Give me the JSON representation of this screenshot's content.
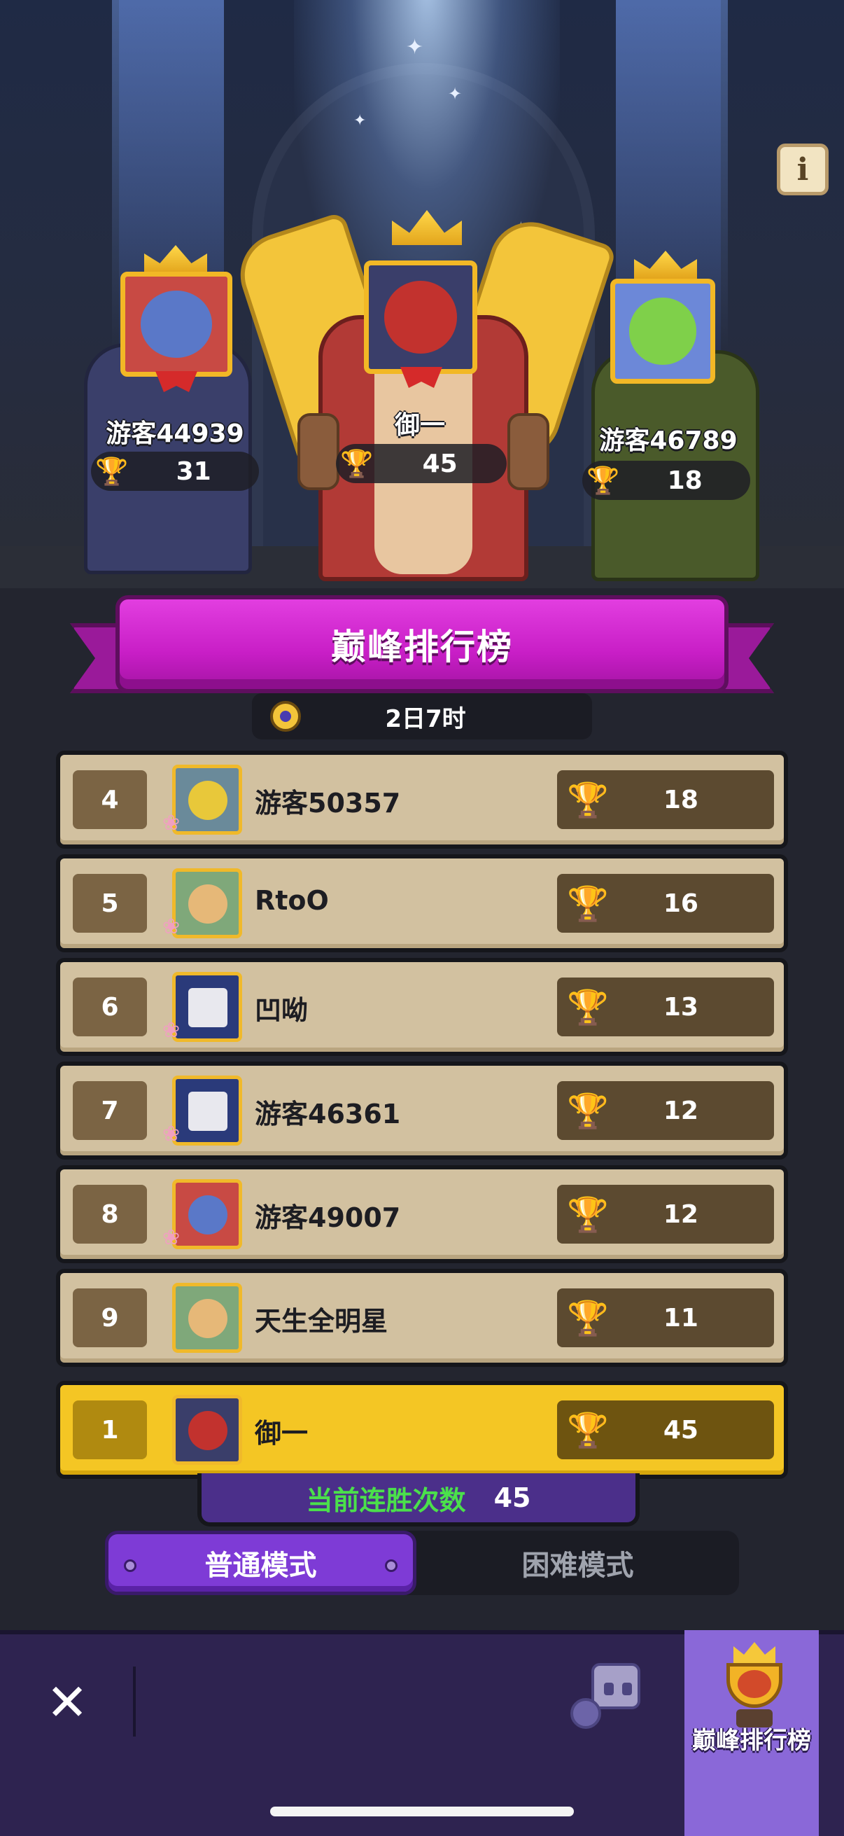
{
  "podium": {
    "first": {
      "name": "御一",
      "trophies": "45",
      "avatar_icon": "red-demon-icon"
    },
    "second": {
      "name": "游客44939",
      "trophies": "31",
      "avatar_icon": "blue-spider-icon"
    },
    "third": {
      "name": "游客46789",
      "trophies": "18",
      "avatar_icon": "green-frog-icon"
    }
  },
  "info_button": {
    "label": "i"
  },
  "banner": {
    "title": "巅峰排行榜"
  },
  "timer": {
    "remaining": "2日7时",
    "icon": "clock-icon"
  },
  "leaderboard": {
    "rows": [
      {
        "rank": "4",
        "name": "游客50357",
        "trophies": "18",
        "avatar_icon": "king-mask-icon"
      },
      {
        "rank": "5",
        "name": "RtoO",
        "trophies": "16",
        "avatar_icon": "elf-girl-icon"
      },
      {
        "rank": "6",
        "name": "凹呦",
        "trophies": "13",
        "avatar_icon": "tv-robot-icon"
      },
      {
        "rank": "7",
        "name": "游客46361",
        "trophies": "12",
        "avatar_icon": "tv-robot-icon"
      },
      {
        "rank": "8",
        "name": "游客49007",
        "trophies": "12",
        "avatar_icon": "blue-spider-icon"
      },
      {
        "rank": "9",
        "name": "天生全明星",
        "trophies": "11",
        "avatar_icon": "elf-girl-icon"
      }
    ],
    "self": {
      "rank": "1",
      "name": "御一",
      "trophies": "45",
      "avatar_icon": "red-demon-icon"
    }
  },
  "streak": {
    "label": "当前连胜次数",
    "value": "45"
  },
  "modes": {
    "normal": "普通模式",
    "hard": "困难模式",
    "selected": "normal"
  },
  "bottom_nav": {
    "close_label": "✕",
    "rank_label": "巅峰排行榜"
  },
  "colors": {
    "banner": "#c81ec6",
    "row_bg": "#d2c1a0",
    "self_row_bg": "#f4c624",
    "mode_active": "#7e3bd6",
    "streak_text": "#4be04b"
  }
}
